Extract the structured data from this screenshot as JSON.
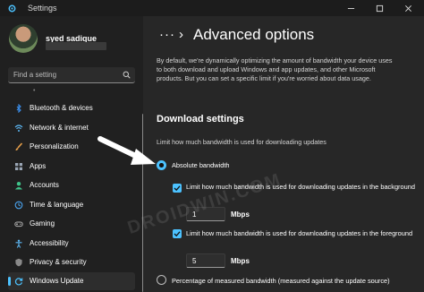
{
  "window": {
    "title": "Settings",
    "controls": [
      "minimize",
      "maximize",
      "close"
    ]
  },
  "user": {
    "name": "syed sadique"
  },
  "search": {
    "placeholder": "Find a setting",
    "icon": "search-icon"
  },
  "sidebar": {
    "items": [
      {
        "label": "Bluetooth & devices",
        "icon": "bluetooth-icon",
        "color": "#3b8eea"
      },
      {
        "label": "Network & internet",
        "icon": "wifi-icon",
        "color": "#5db8f5"
      },
      {
        "label": "Personalization",
        "icon": "brush-icon",
        "color": "#e8a04a"
      },
      {
        "label": "Apps",
        "icon": "apps-icon",
        "color": "#9aa6b5"
      },
      {
        "label": "Accounts",
        "icon": "account-icon",
        "color": "#3fc38a"
      },
      {
        "label": "Time & language",
        "icon": "globe-clock-icon",
        "color": "#4aa3ee"
      },
      {
        "label": "Gaming",
        "icon": "gamepad-icon",
        "color": "#b0b0b0"
      },
      {
        "label": "Accessibility",
        "icon": "accessibility-icon",
        "color": "#5db8f5"
      },
      {
        "label": "Privacy & security",
        "icon": "shield-icon",
        "color": "#8a8a8a"
      },
      {
        "label": "Windows Update",
        "icon": "update-icon",
        "color": "#4cc2ff",
        "selected": true
      }
    ]
  },
  "breadcrumb": {
    "more": "···",
    "separator": "›",
    "title": "Advanced options"
  },
  "description": "By default, we're dynamically optimizing the amount of bandwidth your device uses to both download and upload Windows and app updates, and other Microsoft products. But you can set a specific limit if you're worried about data usage.",
  "download": {
    "title": "Download settings",
    "subtitle": "Limit how much bandwidth is used for downloading updates",
    "absolute_label": "Absolute bandwidth",
    "background_label": "Limit how much bandwidth is used for downloading updates in the background",
    "background_value": "1",
    "foreground_label": "Limit how much bandwidth is used for downloading updates in the foreground",
    "foreground_value": "5",
    "unit": "Mbps",
    "percentage_label": "Percentage of measured bandwidth (measured against the update source)"
  },
  "watermark": "DROIDWIN.COM",
  "colors": {
    "accent": "#4cc2ff",
    "background": "#202020",
    "content": "#272727"
  }
}
